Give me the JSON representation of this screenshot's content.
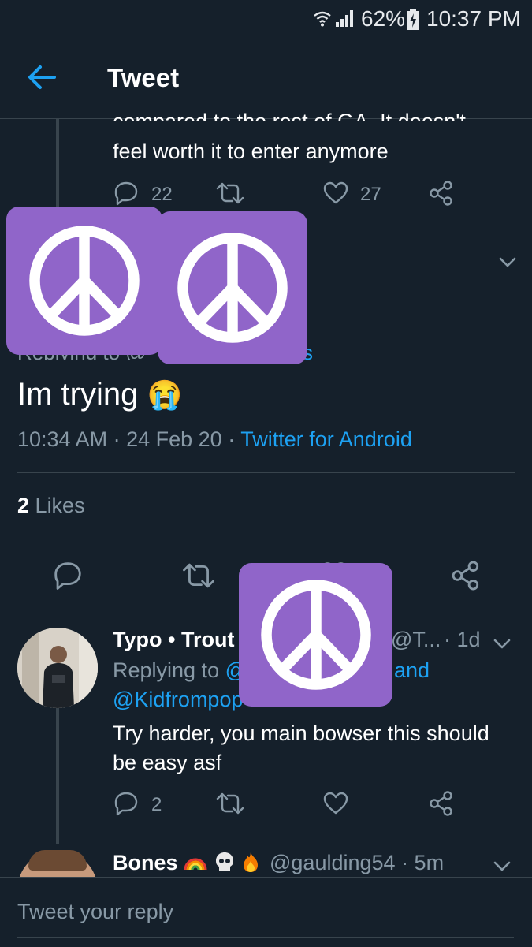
{
  "status_bar": {
    "battery": "62%",
    "time": "10:37 PM"
  },
  "header": {
    "title": "Tweet"
  },
  "prev_tweet": {
    "text_line1": "compared to the rest of GA. It doesn't",
    "text_line2": "feel worth it to enter anymore",
    "replies": "22",
    "likes": "27"
  },
  "main_tweet": {
    "replying_to_fragment": "Replying to @",
    "replying_to_tail": "s",
    "text": "Im trying",
    "emoji": "😭",
    "time": "10:34 AM",
    "sep1": "·",
    "date": "24 Feb 20",
    "sep2": "·",
    "source": "Twitter for Android",
    "likes_count": "2",
    "likes_label": "Likes"
  },
  "reply1": {
    "name": "Typo • Trout",
    "handle_fragment": "@T...",
    "age": "· 1d",
    "replying_prefix": "Replying to",
    "replying_at": "@",
    "replying_and": "and",
    "replying_second": "@Kidfrompop",
    "text_line1": "Try harder,  you main bowser this should",
    "text_line2": "be easy asf",
    "replies": "2"
  },
  "reply2": {
    "name": "Bones",
    "handle": "@gaulding54",
    "age": "· 5m"
  },
  "composer": {
    "placeholder": "Tweet your reply"
  },
  "colors": {
    "background": "#15202b",
    "accent": "#1da1f2",
    "muted": "#8899a6",
    "divider": "#38444d",
    "redaction": "#9065c9"
  }
}
